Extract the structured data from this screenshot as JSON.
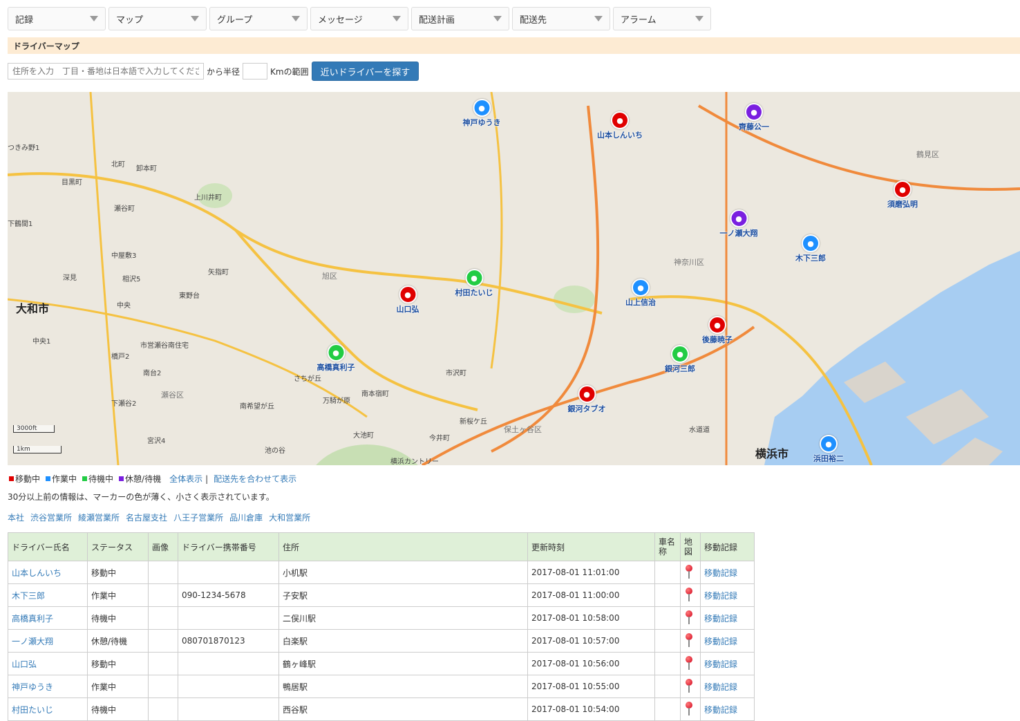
{
  "menu": [
    "記録",
    "マップ",
    "グループ",
    "メッセージ",
    "配送計画",
    "配送先",
    "アラーム"
  ],
  "section_title": "ドライバーマップ",
  "search": {
    "address_placeholder": "住所を入力　丁目・番地は日本語で入力してください",
    "radius_prefix": "から半径",
    "radius_suffix": "Kmの範囲",
    "button_label": "近いドライバーを探す"
  },
  "map": {
    "markers": [
      {
        "name": "神戸ゆうき",
        "status": "作業中"
      },
      {
        "name": "山本しんいち",
        "status": "移動中"
      },
      {
        "name": "齊藤公一",
        "status": "休憩/待機"
      },
      {
        "name": "須磨弘明",
        "status": "移動中"
      },
      {
        "name": "一ノ瀬大翔",
        "status": "休憩/待機"
      },
      {
        "name": "木下三郎",
        "status": "作業中"
      },
      {
        "name": "村田たいじ",
        "status": "待機中"
      },
      {
        "name": "山口弘",
        "status": "移動中"
      },
      {
        "name": "山上信治",
        "status": "作業中"
      },
      {
        "name": "後藤暁子",
        "status": "移動中"
      },
      {
        "name": "高橋真利子",
        "status": "待機中"
      },
      {
        "name": "銀河三郎",
        "status": "待機中"
      },
      {
        "name": "銀河タブオ",
        "status": "移動中"
      },
      {
        "name": "浜田裕二",
        "status": "作業中"
      }
    ],
    "labels": [
      "大和市",
      "横浜市",
      "旭区",
      "瀬谷区",
      "保土ヶ谷区",
      "神奈川区",
      "鶴見区",
      "北町",
      "目黒町",
      "瀬谷町",
      "中屋敷3",
      "相沢5",
      "深見",
      "中央",
      "中央1",
      "橋戸2",
      "南台2",
      "宮沢4",
      "池の谷",
      "大池町",
      "今井町",
      "新桜ケ丘",
      "市沢町",
      "南本宿町",
      "万騎が原",
      "さちが丘",
      "南希望が丘",
      "市営瀬谷南住宅",
      "矢指町",
      "上川井町",
      "卸本町",
      "東野台",
      "下瀬谷2",
      "下鶴間1",
      "つきみ野1",
      "横浜カントリー",
      "水道道"
    ],
    "scale": [
      "3000ft",
      "1km"
    ]
  },
  "legend": {
    "items": [
      {
        "label": "移動中",
        "color": "#e00000"
      },
      {
        "label": "作業中",
        "color": "#1e90ff"
      },
      {
        "label": "待機中",
        "color": "#22cc44"
      },
      {
        "label": "休憩/待機",
        "color": "#7a1fe0"
      }
    ],
    "show_all": "全体表示",
    "separator": "|",
    "show_with_dest": "配送先を合わせて表示"
  },
  "note": "30分以上前の情報は、マーカーの色が薄く、小さく表示されています。",
  "offices": [
    "本社",
    "渋谷営業所",
    "綾瀬営業所",
    "名古屋支社",
    "八王子営業所",
    "品川倉庫",
    "大和営業所"
  ],
  "table": {
    "headers": [
      "ドライバー氏名",
      "ステータス",
      "画像",
      "ドライバー携帯番号",
      "住所",
      "更新時刻",
      "車名称",
      "地図",
      "移動記録"
    ],
    "rows": [
      {
        "name": "山本しんいち",
        "status": "移動中",
        "phone": "",
        "address": "小机駅",
        "updated": "2017-08-01 11:01:00",
        "car": "",
        "log": "移動記録"
      },
      {
        "name": "木下三郎",
        "status": "作業中",
        "phone": "090-1234-5678",
        "address": "子安駅",
        "updated": "2017-08-01 11:00:00",
        "car": "",
        "log": "移動記録"
      },
      {
        "name": "高橋真利子",
        "status": "待機中",
        "phone": "",
        "address": "二俣川駅",
        "updated": "2017-08-01 10:58:00",
        "car": "",
        "log": "移動記録"
      },
      {
        "name": "一ノ瀬大翔",
        "status": "休憩/待機",
        "phone": "080701870123",
        "address": "白楽駅",
        "updated": "2017-08-01 10:57:00",
        "car": "",
        "log": "移動記録"
      },
      {
        "name": "山口弘",
        "status": "移動中",
        "phone": "",
        "address": "鶴ヶ峰駅",
        "updated": "2017-08-01 10:56:00",
        "car": "",
        "log": "移動記録"
      },
      {
        "name": "神戸ゆうき",
        "status": "作業中",
        "phone": "",
        "address": "鴨居駅",
        "updated": "2017-08-01 10:55:00",
        "car": "",
        "log": "移動記録"
      },
      {
        "name": "村田たいじ",
        "status": "待機中",
        "phone": "",
        "address": "西谷駅",
        "updated": "2017-08-01 10:54:00",
        "car": "",
        "log": "移動記録"
      }
    ]
  }
}
